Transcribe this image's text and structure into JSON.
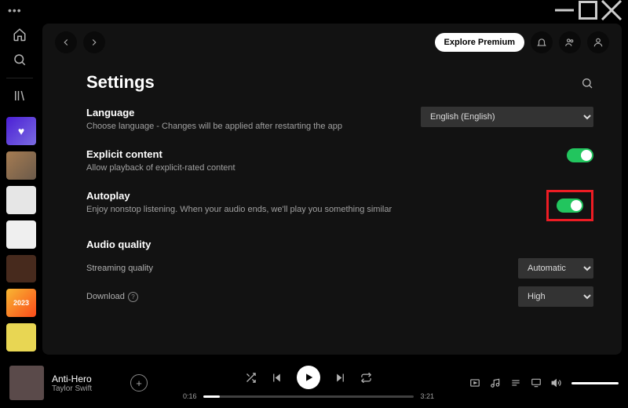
{
  "window": {
    "menu": "•••"
  },
  "toolbar": {
    "explore": "Explore Premium"
  },
  "sidebar": {
    "tiles": [
      "liked",
      "a",
      "b",
      "c",
      "d",
      "2023",
      "f"
    ],
    "year": "2023"
  },
  "settings": {
    "title": "Settings",
    "language": {
      "label": "Language",
      "desc": "Choose language - Changes will be applied after restarting the app",
      "value": "English (English)",
      "options": [
        "English (English)"
      ]
    },
    "explicit": {
      "label": "Explicit content",
      "desc": "Allow playback of explicit-rated content",
      "on": true
    },
    "autoplay": {
      "label": "Autoplay",
      "desc": "Enjoy nonstop listening. When your audio ends, we'll play you something similar",
      "on": true
    },
    "audio": {
      "label": "Audio quality",
      "streaming": {
        "label": "Streaming quality",
        "value": "Automatic",
        "options": [
          "Automatic"
        ]
      },
      "download": {
        "label": "Download",
        "value": "High",
        "options": [
          "High"
        ]
      }
    }
  },
  "player": {
    "track": "Anti-Hero",
    "artist": "Taylor Swift",
    "elapsed": "0:16",
    "total": "3:21"
  }
}
